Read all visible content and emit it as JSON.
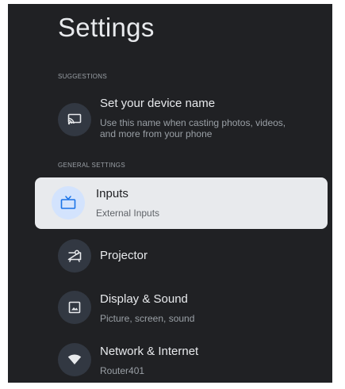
{
  "header": {
    "title": "Settings"
  },
  "sections": {
    "suggestions_label": "SUGGESTIONS",
    "general_label": "GENERAL SETTINGS"
  },
  "suggestion": {
    "title": "Set your device name",
    "subtitle_line1": "Use this name when casting photos, videos,",
    "subtitle_line2": "and more from your phone",
    "icon": "cast-icon"
  },
  "items": [
    {
      "title": "Inputs",
      "subtitle": "External Inputs",
      "icon": "tv-icon",
      "focused": true
    },
    {
      "title": "Projector",
      "subtitle": "",
      "icon": "projector-icon",
      "focused": false
    },
    {
      "title": "Display & Sound",
      "subtitle": "Picture, screen, sound",
      "icon": "image-icon",
      "focused": false
    },
    {
      "title": "Network & Internet",
      "subtitle": "Router401",
      "icon": "wifi-icon",
      "focused": false
    }
  ],
  "colors": {
    "background": "#202124",
    "focus_card": "#e8eaed",
    "focus_icon_bg": "#d3e3fd",
    "accent": "#1a73e8",
    "icon_bg": "#323842"
  }
}
